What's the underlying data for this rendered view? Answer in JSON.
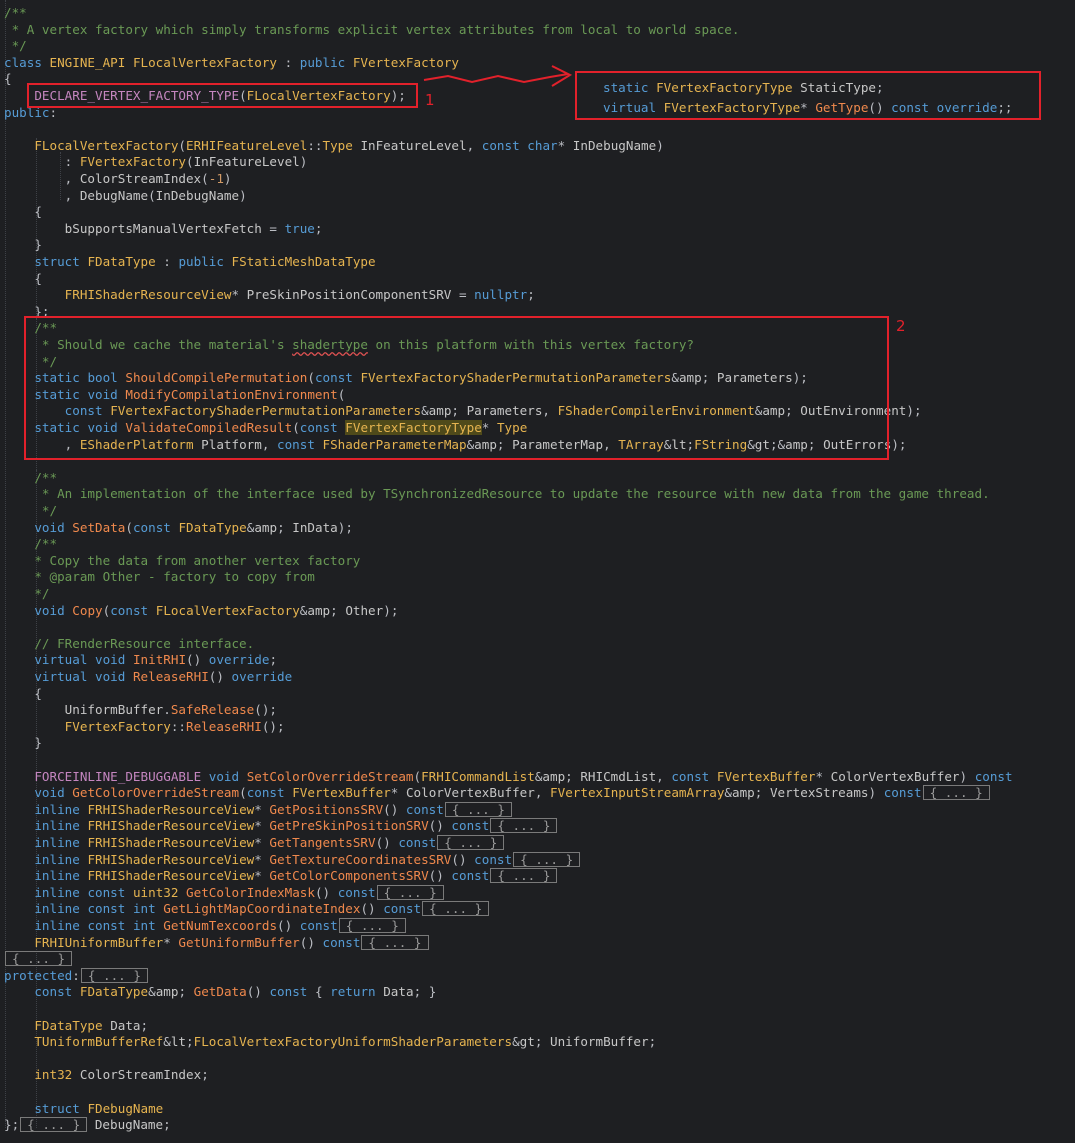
{
  "code_lines": [
    {
      "t": "/**"
    },
    {
      "t": " * A vertex factory which simply transforms explicit vertex attributes from local to world space."
    },
    {
      "t": " */"
    },
    {
      "t": "class ENGINE_API FLocalVertexFactory : public FVertexFactory"
    },
    {
      "t": "{"
    },
    {
      "t": "    DECLARE_VERTEX_FACTORY_TYPE(FLocalVertexFactory);"
    },
    {
      "t": "public:"
    },
    {
      "t": ""
    },
    {
      "t": "    FLocalVertexFactory(ERHIFeatureLevel::Type InFeatureLevel, const char* InDebugName)"
    },
    {
      "t": "        : FVertexFactory(InFeatureLevel)"
    },
    {
      "t": "        , ColorStreamIndex(-1)"
    },
    {
      "t": "        , DebugName(InDebugName)"
    },
    {
      "t": "    {"
    },
    {
      "t": "        bSupportsManualVertexFetch = true;"
    },
    {
      "t": "    }"
    },
    {
      "t": "    struct FDataType : public FStaticMeshDataType"
    },
    {
      "t": "    {"
    },
    {
      "t": "        FRHIShaderResourceView* PreSkinPositionComponentSRV = nullptr;"
    },
    {
      "t": "    };"
    },
    {
      "t": "    /**"
    },
    {
      "t": "     * Should we cache the material's shadertype on this platform with this vertex factory?"
    },
    {
      "t": "     */"
    },
    {
      "t": "    static bool ShouldCompilePermutation(const FVertexFactoryShaderPermutationParameters& Parameters);"
    },
    {
      "t": "    static void ModifyCompilationEnvironment("
    },
    {
      "t": "        const FVertexFactoryShaderPermutationParameters& Parameters, FShaderCompilerEnvironment& OutEnvironment);"
    },
    {
      "t": "    static void ValidateCompiledResult(const FVertexFactoryType* Type"
    },
    {
      "t": "        , EShaderPlatform Platform, const FShaderParameterMap& ParameterMap, TArray<FString>& OutErrors);"
    },
    {
      "t": ""
    },
    {
      "t": "    /**"
    },
    {
      "t": "     * An implementation of the interface used by TSynchronizedResource to update the resource with new data from the game thread."
    },
    {
      "t": "     */"
    },
    {
      "t": "    void SetData(const FDataType& InData);"
    },
    {
      "t": "    /**"
    },
    {
      "t": "    * Copy the data from another vertex factory"
    },
    {
      "t": "    * @param Other - factory to copy from"
    },
    {
      "t": "    */"
    },
    {
      "t": "    void Copy(const FLocalVertexFactory& Other);"
    },
    {
      "t": ""
    },
    {
      "t": "    // FRenderResource interface."
    },
    {
      "t": "    virtual void InitRHI() override;"
    },
    {
      "t": "    virtual void ReleaseRHI() override"
    },
    {
      "t": "    {"
    },
    {
      "t": "        UniformBuffer.SafeRelease();"
    },
    {
      "t": "        FVertexFactory::ReleaseRHI();"
    },
    {
      "t": "    }"
    },
    {
      "t": ""
    },
    {
      "t": "    FORCEINLINE_DEBUGGABLE void SetColorOverrideStream(FRHICommandList& RHICmdList, const FVertexBuffer* ColorVertexBuffer) const"
    },
    {
      "t": "    void GetColorOverrideStream(const FVertexBuffer* ColorVertexBuffer, FVertexInputStreamArray& VertexStreams) const"
    },
    {
      "t": "    inline FRHIShaderResourceView* GetPositionsSRV() const"
    },
    {
      "t": "    inline FRHIShaderResourceView* GetPreSkinPositionSRV() const"
    },
    {
      "t": "    inline FRHIShaderResourceView* GetTangentsSRV() const"
    },
    {
      "t": "    inline FRHIShaderResourceView* GetTextureCoordinatesSRV() const"
    },
    {
      "t": "    inline FRHIShaderResourceView* GetColorComponentsSRV() const"
    },
    {
      "t": "    inline const uint32 GetColorIndexMask() const"
    },
    {
      "t": "    inline const int GetLightMapCoordinateIndex() const"
    },
    {
      "t": "    inline const int GetNumTexcoords() const"
    },
    {
      "t": "    FRHIUniformBuffer* GetUniformBuffer() const"
    },
    {
      "t": ""
    },
    {
      "t": "protected:"
    },
    {
      "t": "    const FDataType& GetData() const { return Data; }"
    },
    {
      "t": ""
    },
    {
      "t": "    FDataType Data;"
    },
    {
      "t": "    TUniformBufferRef<FLocalVertexFactoryUniformShaderParameters> UniformBuffer;"
    },
    {
      "t": ""
    },
    {
      "t": "    int32 ColorStreamIndex;"
    },
    {
      "t": ""
    },
    {
      "t": "    struct FDebugName"
    },
    {
      "t": "};"
    }
  ],
  "fold_marker": "{ ... }",
  "popup_lines": [
    "static FVertexFactoryType StaticType;",
    "virtual FVertexFactoryType* GetType() const override;;"
  ],
  "annotations": {
    "label_1": "1",
    "label_2": "2"
  },
  "colors": {
    "background": "#1e1f22",
    "keyword": "#569cd6",
    "type": "#e6b450",
    "function": "#f0894d",
    "comment": "#6a9955",
    "annotation_red": "#e2212b"
  }
}
